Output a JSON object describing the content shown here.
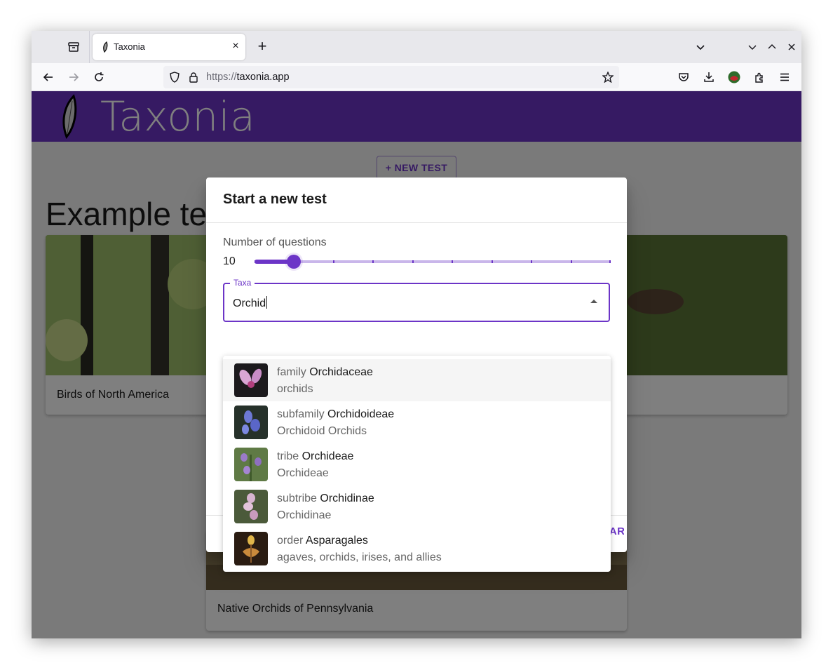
{
  "browser": {
    "tab": {
      "title": "Taxonia",
      "close": "×"
    },
    "new_tab": "+",
    "url": {
      "scheme": "https://",
      "host": "taxonia.app"
    }
  },
  "app": {
    "brand": "Taxonia",
    "new_test_button": "+ NEW TEST",
    "examples_heading": "Example te",
    "cards": [
      {
        "label": "Birds of North America"
      },
      {
        "label": "Native Orchids of Pennsylvania"
      }
    ]
  },
  "dialog": {
    "title": "Start a new test",
    "num_questions_label": "Number of questions",
    "num_questions_value": "10",
    "slider": {
      "min": 0,
      "max": 90,
      "step": 10,
      "value": 10
    },
    "taxa_label": "Taxa",
    "taxa_input": "Orchid",
    "start_button": "START"
  },
  "options": [
    {
      "rank": "family",
      "name": "Orchidaceae",
      "common": "orchids"
    },
    {
      "rank": "subfamily",
      "name": "Orchidoideae",
      "common": "Orchidoid Orchids"
    },
    {
      "rank": "tribe",
      "name": "Orchideae",
      "common": "Orchideae"
    },
    {
      "rank": "subtribe",
      "name": "Orchidinae",
      "common": "Orchidinae"
    },
    {
      "rank": "order",
      "name": "Asparagales",
      "common": "agaves, orchids, irises, and allies"
    }
  ],
  "colors": {
    "primary": "#6c35c7",
    "backdrop": "rgba(0,0,0,0.5)"
  }
}
